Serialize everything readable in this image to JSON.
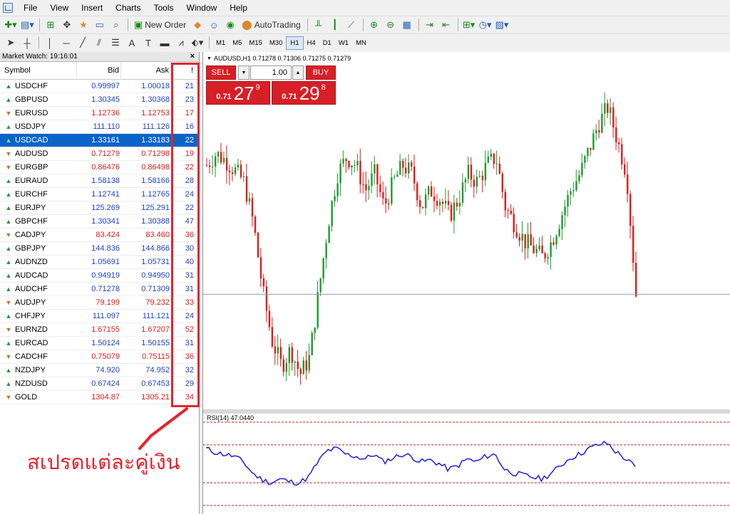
{
  "menu": [
    "File",
    "View",
    "Insert",
    "Charts",
    "Tools",
    "Window",
    "Help"
  ],
  "toolbar": {
    "new_order_label": "New Order",
    "autotrading_label": "AutoTrading",
    "timeframes": [
      "M1",
      "M5",
      "M15",
      "M30",
      "H1",
      "H4",
      "D1",
      "W1",
      "MN"
    ],
    "active_timeframe": "H1"
  },
  "market_watch": {
    "title": "Market Watch: 19:16:01",
    "close_glyph": "×",
    "columns": {
      "symbol": "Symbol",
      "bid": "Bid",
      "ask": "Ask",
      "spread": "!"
    },
    "rows": [
      {
        "symbol": "USDCHF",
        "bid": "0.99997",
        "ask": "1.00018",
        "spread": "21",
        "dir": "up"
      },
      {
        "symbol": "GBPUSD",
        "bid": "1.30345",
        "ask": "1.30368",
        "spread": "23",
        "dir": "up"
      },
      {
        "symbol": "EURUSD",
        "bid": "1.12736",
        "ask": "1.12753",
        "spread": "17",
        "dir": "dn"
      },
      {
        "symbol": "USDJPY",
        "bid": "111.110",
        "ask": "111.126",
        "spread": "16",
        "dir": "up"
      },
      {
        "symbol": "USDCAD",
        "bid": "1.33161",
        "ask": "1.33183",
        "spread": "22",
        "dir": "up",
        "selected": true
      },
      {
        "symbol": "AUDUSD",
        "bid": "0.71279",
        "ask": "0.71298",
        "spread": "19",
        "dir": "dn"
      },
      {
        "symbol": "EURGBP",
        "bid": "0.86476",
        "ask": "0.86498",
        "spread": "22",
        "dir": "dn"
      },
      {
        "symbol": "EURAUD",
        "bid": "1.58138",
        "ask": "1.58166",
        "spread": "28",
        "dir": "up"
      },
      {
        "symbol": "EURCHF",
        "bid": "1.12741",
        "ask": "1.12765",
        "spread": "24",
        "dir": "up"
      },
      {
        "symbol": "EURJPY",
        "bid": "125.269",
        "ask": "125.291",
        "spread": "22",
        "dir": "up"
      },
      {
        "symbol": "GBPCHF",
        "bid": "1.30341",
        "ask": "1.30388",
        "spread": "47",
        "dir": "up"
      },
      {
        "symbol": "CADJPY",
        "bid": "83.424",
        "ask": "83.460",
        "spread": "36",
        "dir": "dn"
      },
      {
        "symbol": "GBPJPY",
        "bid": "144.836",
        "ask": "144.866",
        "spread": "30",
        "dir": "up"
      },
      {
        "symbol": "AUDNZD",
        "bid": "1.05691",
        "ask": "1.05731",
        "spread": "40",
        "dir": "up"
      },
      {
        "symbol": "AUDCAD",
        "bid": "0.94919",
        "ask": "0.94950",
        "spread": "31",
        "dir": "up"
      },
      {
        "symbol": "AUDCHF",
        "bid": "0.71278",
        "ask": "0.71309",
        "spread": "31",
        "dir": "up"
      },
      {
        "symbol": "AUDJPY",
        "bid": "79.199",
        "ask": "79.232",
        "spread": "33",
        "dir": "dn"
      },
      {
        "symbol": "CHFJPY",
        "bid": "111.097",
        "ask": "111.121",
        "spread": "24",
        "dir": "up"
      },
      {
        "symbol": "EURNZD",
        "bid": "1.67155",
        "ask": "1.67207",
        "spread": "52",
        "dir": "dn"
      },
      {
        "symbol": "EURCAD",
        "bid": "1.50124",
        "ask": "1.50155",
        "spread": "31",
        "dir": "up"
      },
      {
        "symbol": "CADCHF",
        "bid": "0.75079",
        "ask": "0.75115",
        "spread": "36",
        "dir": "dn"
      },
      {
        "symbol": "NZDJPY",
        "bid": "74.920",
        "ask": "74.952",
        "spread": "32",
        "dir": "up"
      },
      {
        "symbol": "NZDUSD",
        "bid": "0.67424",
        "ask": "0.67453",
        "spread": "29",
        "dir": "up"
      },
      {
        "symbol": "GOLD",
        "bid": "1304.87",
        "ask": "1305.21",
        "spread": "34",
        "dir": "dn"
      }
    ]
  },
  "annotation": {
    "text": "สเปรดแต่ละคู่เงิน",
    "color": "#e5232b"
  },
  "chart": {
    "title": "AUDUSD,H1  0.71278 0.71306 0.71275 0.71279",
    "one_click": {
      "sell_label": "SELL",
      "buy_label": "BUY",
      "lot": "1.00",
      "sell_prefix": "0.71",
      "sell_big": "27",
      "sell_sup": "9",
      "buy_prefix": "0.71",
      "buy_big": "29",
      "buy_sup": "8"
    },
    "rsi_title": "RSI(14) 47.0440",
    "colors": {
      "bull": "#1e9a2e",
      "bear": "#e01b1b",
      "rsi": "#1f1fe0",
      "level": "#e01b1b",
      "bid_line": "#8aa0b8"
    }
  },
  "chart_data": {
    "type": "candlestick",
    "series": [
      {
        "name": "AUDUSD,H1",
        "close_path": [
          0.7205,
          0.7212,
          0.7208,
          0.7202,
          0.7195,
          0.717,
          0.713,
          0.71,
          0.7085,
          0.7095,
          0.708,
          0.709,
          0.713,
          0.717,
          0.72,
          0.721,
          0.7205,
          0.719,
          0.72,
          0.718,
          0.7195,
          0.7205,
          0.72,
          0.718,
          0.719,
          0.7185,
          0.7175,
          0.7185,
          0.72,
          0.7195,
          0.7205,
          0.721,
          0.718,
          0.717,
          0.716,
          0.7155,
          0.715,
          0.716,
          0.7175,
          0.719,
          0.72,
          0.7215,
          0.723,
          0.724,
          0.722,
          0.72,
          0.71279
        ]
      },
      {
        "name": "RSI(14)",
        "values": [
          66,
          62,
          60,
          58,
          52,
          40,
          33,
          30,
          34,
          31,
          30,
          36,
          52,
          64,
          66,
          60,
          58,
          55,
          60,
          52,
          56,
          60,
          58,
          52,
          54,
          50,
          44,
          48,
          55,
          52,
          58,
          60,
          44,
          40,
          38,
          36,
          34,
          40,
          48,
          56,
          60,
          66,
          70,
          72,
          62,
          55,
          47.044
        ]
      }
    ],
    "rsi_levels": [
      70,
      30
    ]
  }
}
